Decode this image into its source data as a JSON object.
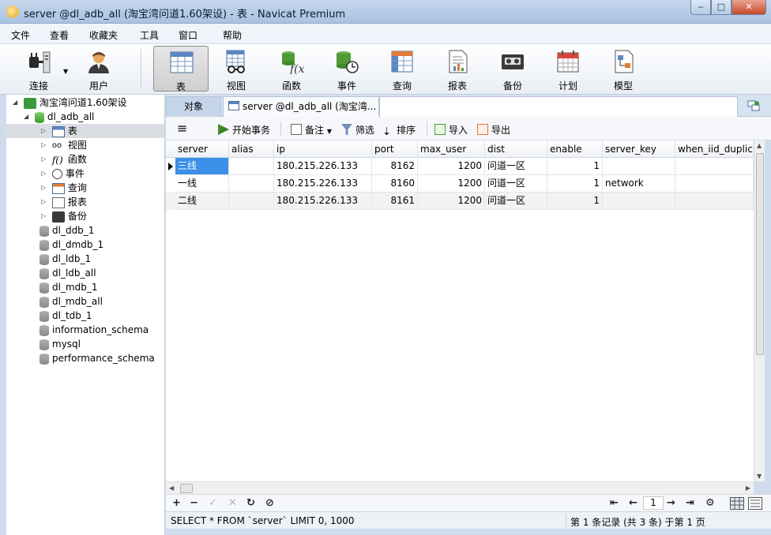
{
  "window": {
    "title": "server @dl_adb_all (淘宝湾问道1.60架设) - 表 - Navicat Premium",
    "minimize": "‒",
    "maximize": "□",
    "close": "✕"
  },
  "menu": [
    "文件",
    "查看",
    "收藏夹",
    "工具",
    "窗口",
    "帮助"
  ],
  "toolbar": [
    {
      "label": "连接",
      "icon": "connection-plug-icon"
    },
    {
      "label": "用户",
      "icon": "user-icon"
    },
    {
      "label": "表",
      "icon": "table-icon",
      "active": true
    },
    {
      "label": "视图",
      "icon": "view-glasses-icon"
    },
    {
      "label": "函数",
      "icon": "function-icon"
    },
    {
      "label": "事件",
      "icon": "event-clock-icon"
    },
    {
      "label": "查询",
      "icon": "query-icon"
    },
    {
      "label": "报表",
      "icon": "report-icon"
    },
    {
      "label": "备份",
      "icon": "backup-tape-icon"
    },
    {
      "label": "计划",
      "icon": "schedule-calendar-icon"
    },
    {
      "label": "模型",
      "icon": "model-icon"
    }
  ],
  "tree": {
    "connection": "淘宝湾问道1.60架设",
    "open_db": "dl_adb_all",
    "objects": [
      "表",
      "视图",
      "函数",
      "事件",
      "查询",
      "报表",
      "备份"
    ],
    "databases": [
      "dl_ddb_1",
      "dl_dmdb_1",
      "dl_ldb_1",
      "dl_ldb_all",
      "dl_mdb_1",
      "dl_mdb_all",
      "dl_tdb_1",
      "information_schema",
      "mysql",
      "performance_schema"
    ]
  },
  "tabs": {
    "objects": "对象",
    "active": "server @dl_adb_all (淘宝湾..."
  },
  "table_toolbar": {
    "menu_icon": "≡",
    "begin_transaction": "开始事务",
    "memo": "备注",
    "filter": "筛选",
    "sort": "排序",
    "import": "导入",
    "export": "导出"
  },
  "grid": {
    "columns": [
      "server",
      "alias",
      "ip",
      "port",
      "max_user",
      "dist",
      "enable",
      "server_key",
      "when_iid_duplica"
    ],
    "rows": [
      [
        "三线",
        "",
        "180.215.226.133",
        "8162",
        "1200",
        "问道一区",
        "1",
        "",
        ""
      ],
      [
        "一线",
        "",
        "180.215.226.133",
        "8160",
        "1200",
        "问道一区",
        "1",
        "network",
        ""
      ],
      [
        "二线",
        "",
        "180.215.226.133",
        "8161",
        "1200",
        "问道一区",
        "1",
        "",
        ""
      ]
    ]
  },
  "footer": {
    "add": "+",
    "remove": "−",
    "apply": "✓",
    "discard": "✕",
    "refresh": "↻",
    "stop": "⊘",
    "first": "⇤",
    "prev": "←",
    "page": "1",
    "next": "→",
    "last": "⇥",
    "settings": "⚙"
  },
  "status": {
    "sql": "SELECT * FROM `server` LIMIT 0, 1000",
    "records": "第 1 条记录 (共 3 条) 于第 1 页"
  },
  "colors": {
    "selection": "#3b8fe6",
    "titlebar": "#b7cde8"
  }
}
